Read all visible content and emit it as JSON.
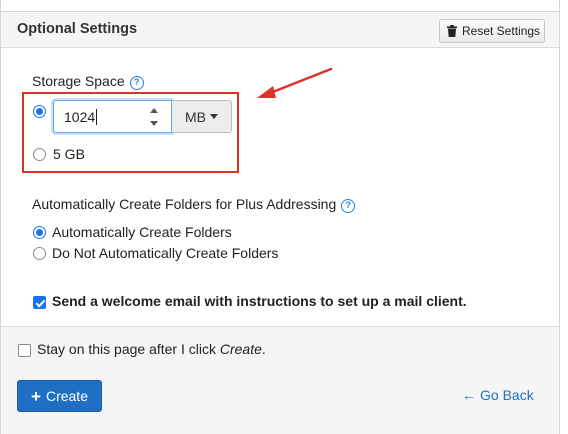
{
  "header": {
    "title": "Optional Settings",
    "reset_label": "Reset Settings",
    "reset_icon": "trash-icon"
  },
  "storage": {
    "label": "Storage Space",
    "help_icon": "?",
    "custom_value": "1024",
    "unit": "MB",
    "option_5gb": "5 GB",
    "selected": "custom"
  },
  "folders": {
    "label": "Automatically Create Folders for Plus Addressing",
    "help_icon": "?",
    "option_auto": "Automatically Create Folders",
    "option_manual": "Do Not Automatically Create Folders",
    "selected": "auto"
  },
  "welcome_email": {
    "label": "Send a welcome email with instructions to set up a mail client.",
    "checked": true
  },
  "footer": {
    "stay_prefix": "Stay on this page after I click ",
    "stay_emph": "Create",
    "stay_suffix": ".",
    "stay_checked": false,
    "create_label": "Create",
    "create_icon": "+",
    "go_back_label": "Go Back",
    "go_back_icon": "←"
  },
  "colors": {
    "accent": "#1f6fc5",
    "highlight": "#e0302a"
  }
}
